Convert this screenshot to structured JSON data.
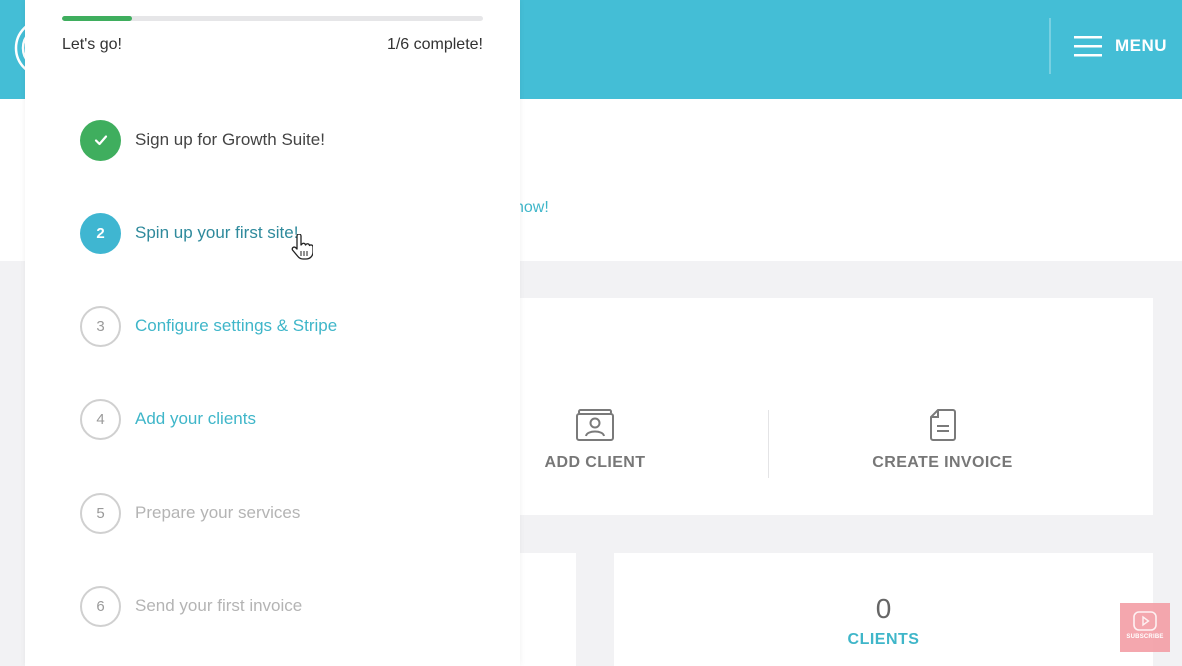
{
  "header": {
    "logo_icon": "concentric-circles-logo",
    "menu_icon": "hamburger-icon",
    "menu_label": "MENU",
    "brand_color": "#44bed6"
  },
  "onboarding": {
    "progress_fraction": 0.1667,
    "progress_label": "Let's go!",
    "progress_status": "1/6 complete!",
    "steps": [
      {
        "number": "✓",
        "label": "Sign up for Growth Suite!",
        "state": "done"
      },
      {
        "number": "2",
        "label": "Spin up your first site!",
        "state": "active"
      },
      {
        "number": "3",
        "label": "Configure settings & Stripe",
        "state": "link"
      },
      {
        "number": "4",
        "label": "Add your clients",
        "state": "link"
      },
      {
        "number": "5",
        "label": "Prepare your services",
        "state": "muted"
      },
      {
        "number": "6",
        "label": "Send your first invoice",
        "state": "muted"
      }
    ],
    "colors": {
      "done": "#3fae5e",
      "active": "#3fb6d1",
      "link": "#3fb6c9",
      "muted": "#b4b4b4"
    }
  },
  "main": {
    "hero_link_text": "now!",
    "actions": [
      {
        "icon": "client-card-icon",
        "label": "ADD CLIENT"
      },
      {
        "icon": "document-icon",
        "label": "CREATE INVOICE"
      }
    ],
    "stats": [
      {
        "value": "0",
        "label": "CLIENTS"
      }
    ]
  },
  "overlay": {
    "subscribe_icon": "play-button-icon",
    "subscribe_label": "SUBSCRIBE"
  }
}
